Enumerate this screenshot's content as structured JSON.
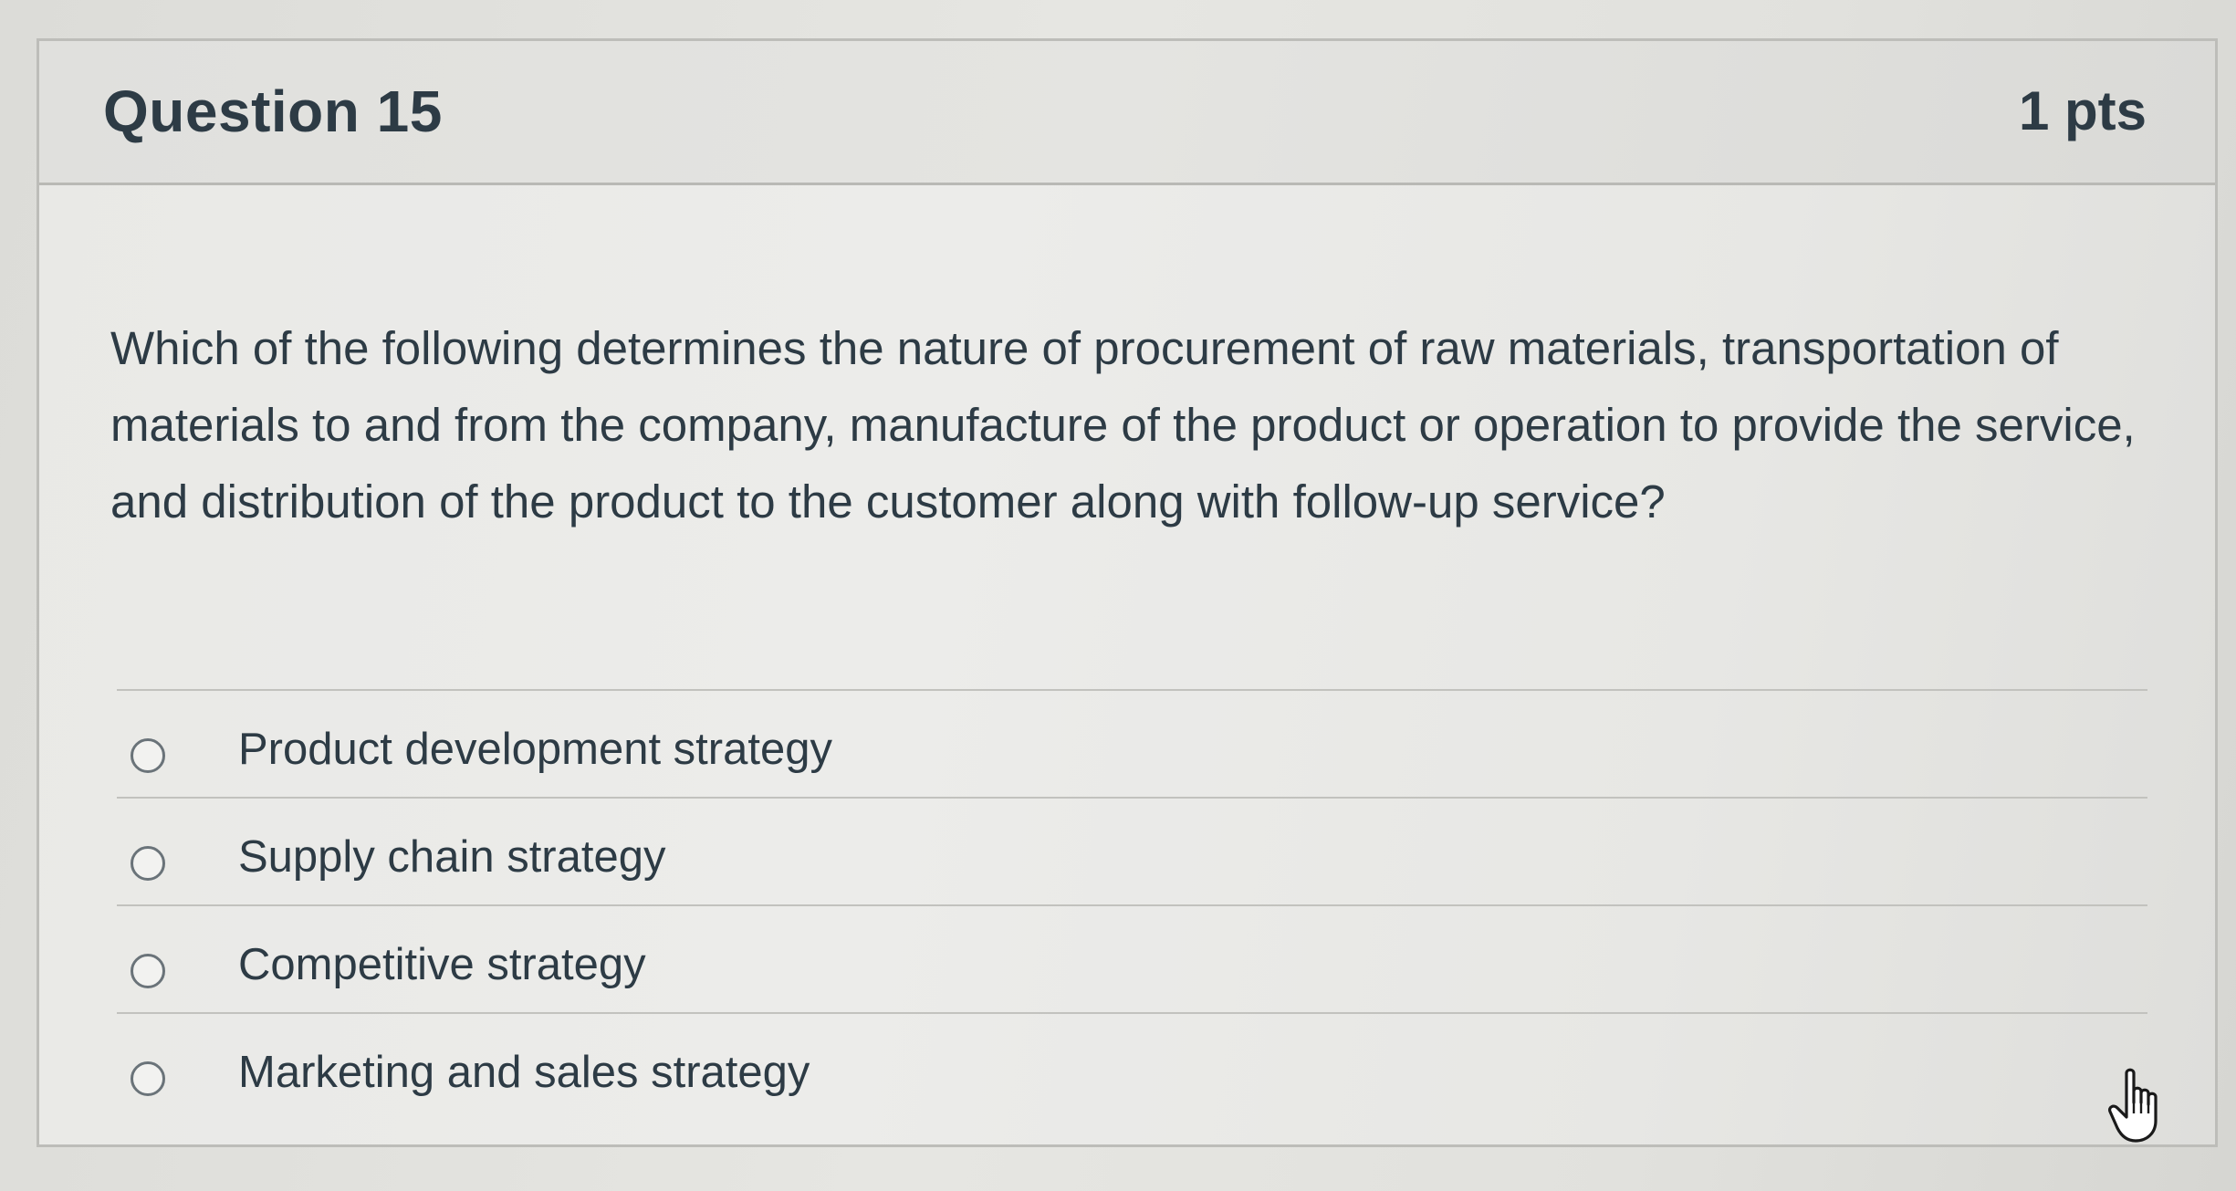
{
  "question": {
    "title": "Question 15",
    "points": "1 pts",
    "text": "Which of the following determines the nature of procurement of raw materials, transportation of materials to and from the company, manufacture of the product or operation to provide the service, and distribution of the product to the customer along with follow-up service?"
  },
  "answers": [
    {
      "label": "Product development strategy",
      "selected": false
    },
    {
      "label": "Supply chain strategy",
      "selected": false
    },
    {
      "label": "Competitive strategy",
      "selected": false
    },
    {
      "label": "Marketing and sales strategy",
      "selected": false
    }
  ],
  "cursor": {
    "icon": "hand-pointer-icon"
  },
  "colors": {
    "text": "#2d3b45",
    "border": "#bdbdb9",
    "background": "#e9e9e6"
  }
}
